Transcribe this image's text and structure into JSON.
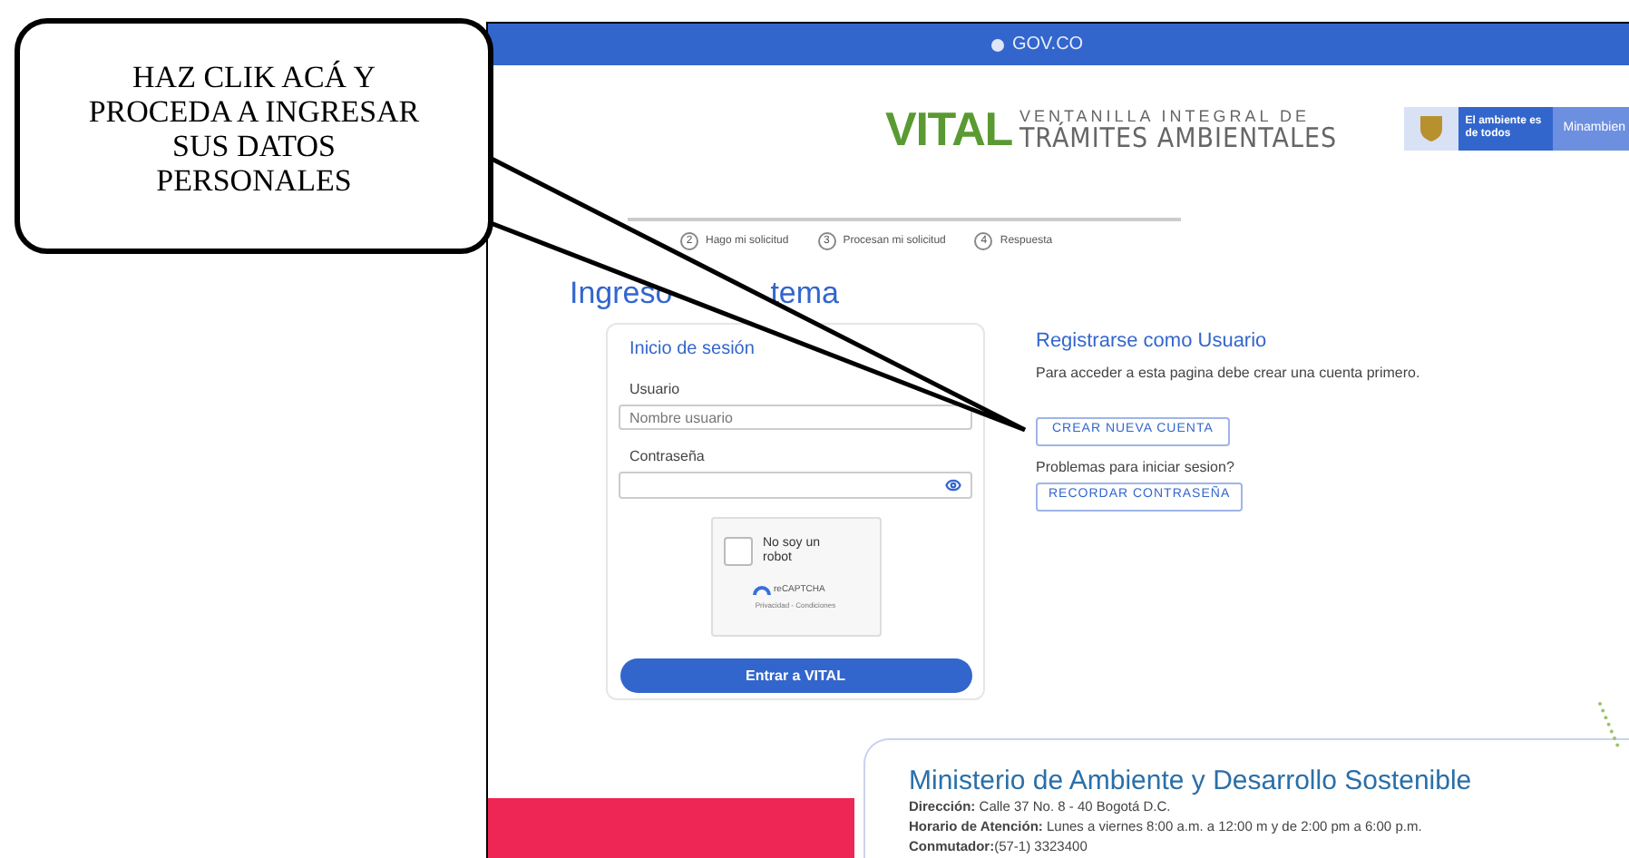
{
  "callout": {
    "text": "HAZ CLIK ACÁ Y PROCEDA A INGRESAR SUS DATOS PERSONALES"
  },
  "top_bar": {
    "label": "GOV.CO"
  },
  "header": {
    "logo_word": "VITAL",
    "logo_line_1": "VENTANILLA INTEGRAL DE",
    "logo_line_2": "TRÁMITES AMBIENTALES",
    "badge_text": "El ambiente es de todos",
    "badge_brand": "Minambien"
  },
  "steps": [
    {
      "number": "2",
      "label": "Hago mi solicitud"
    },
    {
      "number": "3",
      "label": "Procesan mi solicitud"
    },
    {
      "number": "4",
      "label": "Respuesta"
    }
  ],
  "heading_parts": [
    "Ingreso",
    "tema"
  ],
  "login": {
    "title": "Inicio de sesión",
    "user_label": "Usuario",
    "user_placeholder": "Nombre usuario",
    "password_label": "Contraseña",
    "captcha": {
      "checked": false,
      "label": "No soy un robot",
      "brand": "reCAPTCHA",
      "links": "Privacidad - Condiciones"
    },
    "submit": "Entrar a VITAL"
  },
  "register": {
    "title": "Registrarse como Usuario",
    "text": "Para acceder a esta pagina debe crear una cuenta primero.",
    "create_button": "CREAR NUEVA CUENTA",
    "problems": "Problemas para iniciar sesion?",
    "remember_button": "RECORDAR CONTRASEÑA"
  },
  "footer": {
    "title": "Ministerio de Ambiente y Desarrollo Sostenible",
    "lines": [
      "**Dirección:** Calle 37 No. 8 - 40 Bogotá D.C.",
      "**Horario de Atención:** Lunes a viernes 8:00 a.m. a 12:00 m y de 2:00 pm a 6:00 p.m.",
      "**Conmutador:**(57-1) 3323400"
    ]
  }
}
